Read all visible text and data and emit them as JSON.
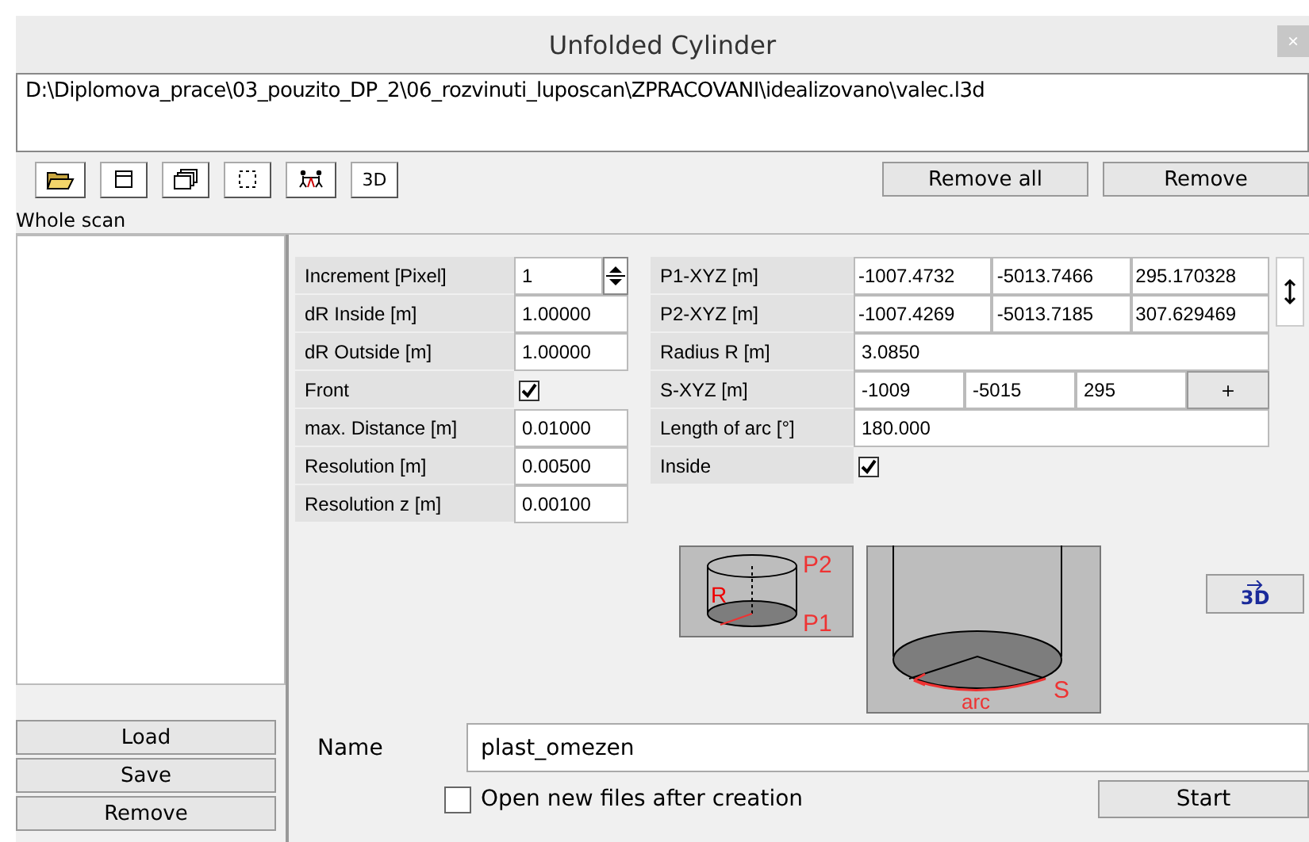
{
  "window": {
    "title": "Unfolded Cylinder",
    "close": "×"
  },
  "path": "D:\\Diplomova_prace\\03_pouzito_DP_2\\06_rozvinuti_luposcan\\ZPRACOVANI\\idealizovano\\valec.l3d",
  "toolbar": [
    {
      "kind": "folder"
    },
    {
      "kind": "window"
    },
    {
      "kind": "windows"
    },
    {
      "kind": "selection"
    },
    {
      "kind": "figures"
    },
    {
      "kind": "text",
      "label": "3D"
    }
  ],
  "remove_all": "Remove all",
  "remove": "Remove",
  "scan_label": "Whole scan",
  "left_buttons": [
    "Load",
    "Save",
    "Remove"
  ],
  "params": [
    {
      "label": "Increment [Pixel]",
      "kind": "spin",
      "value": "1"
    },
    {
      "label": "dR Inside [m]",
      "kind": "input",
      "value": "1.00000"
    },
    {
      "label": "dR Outside [m]",
      "kind": "input",
      "value": "1.00000"
    },
    {
      "label": "Front",
      "kind": "check",
      "checked": true
    },
    {
      "label": "max. Distance [m]",
      "kind": "input",
      "value": "0.01000"
    },
    {
      "label": "Resolution [m]",
      "kind": "input",
      "value": "0.00500"
    },
    {
      "label": "Resolution z [m]",
      "kind": "input",
      "value": "0.00100"
    }
  ],
  "geometry": [
    {
      "label": "P1-XYZ [m]",
      "kind": "triple",
      "values": [
        "-1007.4732",
        "-5013.7466",
        "295.170328"
      ]
    },
    {
      "label": "P2-XYZ [m]",
      "kind": "triple",
      "values": [
        "-1007.4269",
        "-5013.7185",
        "307.629469"
      ]
    },
    {
      "label": "Radius R [m]",
      "kind": "input",
      "value": "3.0850"
    },
    {
      "label": "S-XYZ [m]",
      "kind": "triple_plus",
      "values": [
        "-1009",
        "-5015",
        "295"
      ],
      "button": "+"
    },
    {
      "label": "Length of arc [°]",
      "kind": "input",
      "value": "180.000"
    },
    {
      "label": "Inside",
      "kind": "check",
      "checked": true
    }
  ],
  "cylinder_labels": {
    "top": "P2",
    "bottom": "P1",
    "radius": "R"
  },
  "arc_labels": {
    "arc": "arc",
    "start": "S"
  },
  "view_button": "3D",
  "name": {
    "label": "Name",
    "value": "plast_omezen"
  },
  "open_new": {
    "label": "Open new files after creation",
    "checked": false
  },
  "start": "Start"
}
